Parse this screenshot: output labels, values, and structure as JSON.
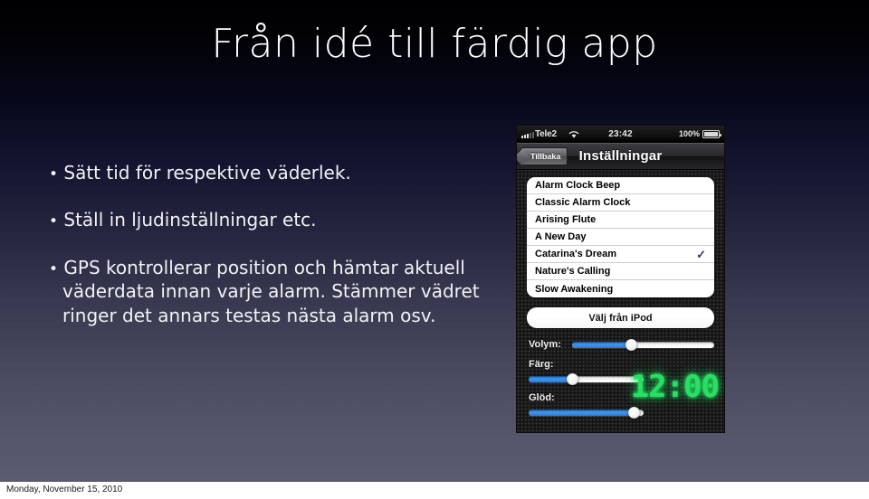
{
  "slide": {
    "title": "Från idé till färdig app",
    "bullets": [
      "Sätt tid för respektive väderlek.",
      "Ställ in ljudinställningar etc.",
      "GPS kontrollerar position och hämtar aktuell väderdata innan varje alarm. Stämmer vädret ringer det annars testas nästa alarm osv."
    ],
    "bullet_marker": "•",
    "background_top_color": "#000000",
    "background_bottom_color": "#5a5a70",
    "title_color": "#ffffff"
  },
  "phone": {
    "status_bar": {
      "carrier": "Tele2",
      "time": "23:42",
      "battery_percent": "100%",
      "signal_icon": "signal-bars-icon",
      "wifi_icon": "wifi-icon",
      "battery_icon": "battery-icon"
    },
    "nav_bar": {
      "back_label": "Tillbaka",
      "title": "Inställningar"
    },
    "sound_list": [
      {
        "label": "Alarm Clock Beep",
        "selected": false
      },
      {
        "label": "Classic Alarm Clock",
        "selected": false
      },
      {
        "label": "Arising Flute",
        "selected": false
      },
      {
        "label": "A New Day",
        "selected": false
      },
      {
        "label": "Catarina's Dream",
        "selected": true
      },
      {
        "label": "Nature's Calling",
        "selected": false
      },
      {
        "label": "Slow Awakening",
        "selected": false
      }
    ],
    "checkmark_glyph": "✓",
    "checkmark_color": "#2b3a6b",
    "ipod_button_label": "Välj från iPod",
    "sliders": [
      {
        "label": "Volym:",
        "value": 42
      },
      {
        "label": "Färg:",
        "value": 38
      },
      {
        "label": "Glöd:",
        "value": 92
      }
    ],
    "slider_fill_color": "#3f96ec",
    "led_clock": {
      "time": "12:00",
      "color": "#27e062"
    }
  },
  "footer": {
    "date": "Monday, November 15, 2010"
  }
}
